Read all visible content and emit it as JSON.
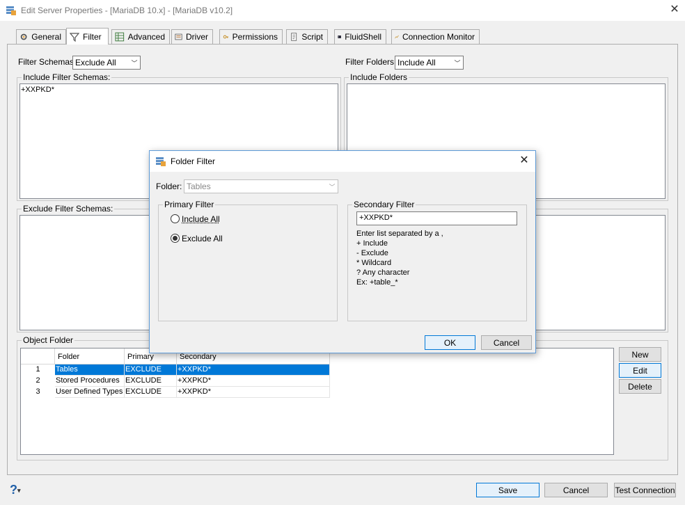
{
  "window": {
    "title": "Edit Server Properties - [MariaDB 10.x] - [MariaDB v10.2]",
    "close_icon": "close-icon"
  },
  "tabs": [
    {
      "label": "General",
      "icon": "general-icon",
      "active": false
    },
    {
      "label": "Filter",
      "icon": "filter-icon",
      "active": true
    },
    {
      "label": "Advanced",
      "icon": "advanced-icon",
      "active": false
    },
    {
      "label": "Driver",
      "icon": "driver-icon",
      "active": false
    },
    {
      "label": "Permissions",
      "icon": "permissions-icon",
      "active": false
    },
    {
      "label": "Script",
      "icon": "script-icon",
      "active": false
    },
    {
      "label": "FluidShell",
      "icon": "fluidshell-icon",
      "active": false
    },
    {
      "label": "Connection Monitor",
      "icon": "connection-monitor-icon",
      "active": false
    }
  ],
  "filter": {
    "schemas_label": "Filter Schemas:",
    "schemas_value": "Exclude All",
    "folders_label": "Filter Folders:",
    "folders_value": "Include All",
    "include_schemas_title": "Include Filter Schemas:",
    "include_schemas_text": "+XXPKD*",
    "include_folders_title": "Include Folders",
    "include_folders_text": "",
    "exclude_schemas_title": "Exclude Filter Schemas:",
    "exclude_schemas_text": ""
  },
  "object_folder": {
    "title": "Object Folder",
    "columns": [
      "Folder",
      "Primary",
      "Secondary"
    ],
    "rows": [
      {
        "num": "1",
        "folder": "Tables",
        "primary": "EXCLUDE",
        "secondary": "+XXPKD*",
        "selected": true
      },
      {
        "num": "2",
        "folder": "Stored Procedures",
        "primary": "EXCLUDE",
        "secondary": "+XXPKD*",
        "selected": false
      },
      {
        "num": "3",
        "folder": "User Defined Types",
        "primary": "EXCLUDE",
        "secondary": "+XXPKD*",
        "selected": false
      }
    ],
    "new_label": "New",
    "edit_label": "Edit",
    "delete_label": "Delete"
  },
  "footer": {
    "help": "?",
    "save": "Save",
    "cancel": "Cancel",
    "test_connection": "Test Connection"
  },
  "dialog": {
    "title": "Folder Filter",
    "folder_label": "Folder:",
    "folder_value": "Tables",
    "primary_title": "Primary Filter",
    "include_all": "Include All",
    "exclude_all": "Exclude All",
    "primary_selected": "exclude",
    "secondary_title": "Secondary Filter",
    "secondary_value": "+XXPKD*",
    "help_text": "Enter list separated by a ,\n+ Include\n- Exclude\n* Wildcard\n? Any character\nEx: +table_*",
    "ok": "OK",
    "cancel": "Cancel"
  },
  "colors": {
    "selection": "#0078d7",
    "window_bg": "#f0f0f0"
  }
}
